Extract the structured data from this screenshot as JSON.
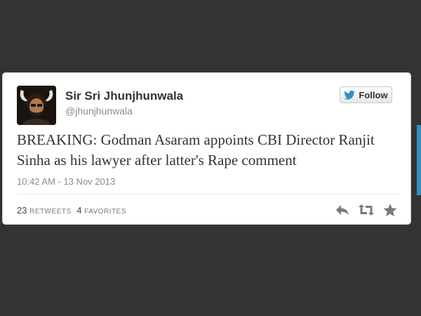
{
  "tweet": {
    "display_name": "Sir Sri Jhunjhunwala",
    "screen_name": "@jhunjhunwala",
    "text": "BREAKING: Godman Asaram appoints CBI Director Ranjit Sinha as his lawyer after latter's Rape comment",
    "timestamp": "10:42 AM - 13 Nov 2013",
    "retweets_count": "23",
    "retweets_label": "RETWEETS",
    "favorites_count": "4",
    "favorites_label": "FAVORITES"
  },
  "follow_button": {
    "label": "Follow",
    "icon": "twitter-bird-icon"
  },
  "actions": [
    {
      "icon": "reply-icon"
    },
    {
      "icon": "retweet-icon"
    },
    {
      "icon": "favorite-star-icon"
    }
  ],
  "colors": {
    "background": "#333333",
    "card": "#ffffff",
    "twitter_blue": "#2f8fc4",
    "action_gray": "#7a7a7a"
  }
}
